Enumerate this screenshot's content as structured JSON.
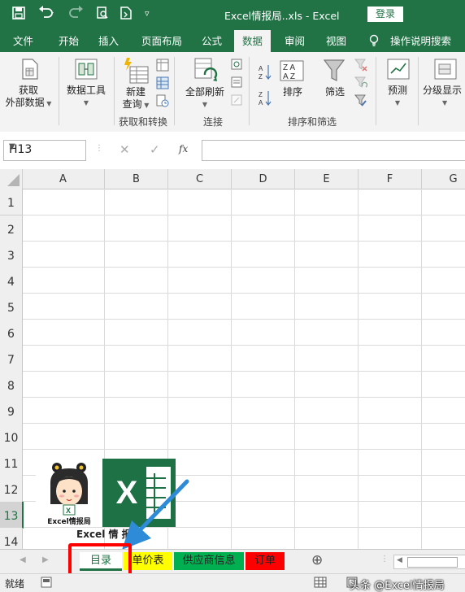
{
  "titlebar": {
    "title": "Excel情报局..xls  -  Excel",
    "login_label": "登录"
  },
  "ribbon_tabs": [
    "文件",
    "开始",
    "插入",
    "页面布局",
    "公式",
    "数据",
    "审阅",
    "视图",
    "操作说明搜索"
  ],
  "ribbon": {
    "get_external_data": [
      "获取",
      "外部数据"
    ],
    "data_tools": "数据工具",
    "new_query": [
      "新建",
      "查询"
    ],
    "group_get_transform": "获取和转换",
    "refresh_all": "全部刷新",
    "group_connections": "连接",
    "sort_az": "A Z",
    "sort_label": "排序",
    "filter_label": "筛选",
    "group_sort_filter": "排序和筛选",
    "forecast_label": "预测",
    "outline_label": "分级显示"
  },
  "formula_bar": {
    "name_box": "H13",
    "fx": "fx",
    "value": ""
  },
  "columns": [
    "A",
    "B",
    "C",
    "D",
    "E",
    "F",
    "G"
  ],
  "rows": [
    "1",
    "2",
    "3",
    "4",
    "5",
    "6",
    "7",
    "8",
    "9",
    "10",
    "11",
    "12",
    "13",
    "14"
  ],
  "selected_row": "13",
  "overlay": {
    "cartoon_caption": "Excel情报局",
    "logo_letter": "X",
    "cut_caption": "Excel 情 报"
  },
  "sheet_tabs": [
    {
      "label": "目录",
      "color": "#ffffff"
    },
    {
      "label": "单价表",
      "color": "#ffff00"
    },
    {
      "label": "供应商信息",
      "color": "#00b050"
    },
    {
      "label": "订单",
      "color": "#ff0000"
    }
  ],
  "add_sheet": "⊕",
  "status": {
    "ready": "就绪",
    "watermark": "头条 @Excel情报局"
  },
  "colors": {
    "excel_green": "#217346",
    "highlight_red": "#ff0000",
    "arrow_blue": "#2d8bd8"
  }
}
